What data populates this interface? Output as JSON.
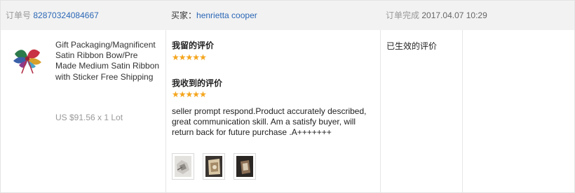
{
  "header": {
    "order_label": "订单号",
    "order_number": "82870324084667",
    "buyer_label": "买家：",
    "buyer_name": "henrietta cooper",
    "finish_label": "订单完成",
    "finish_time": "2017.04.07 10:29"
  },
  "product": {
    "title": "Gift Packaging/Magnificent Satin Ribbon Bow/Pre Made Medium Satin Ribbon with Sticker Free Shipping",
    "price": "US $91.56 x 1 Lot",
    "image_icon": "ribbon-bow-icon"
  },
  "feedback": {
    "my_rating_heading": "我留的评价",
    "my_rating_stars": 5,
    "received_heading": "我收到的评价",
    "received_stars": 5,
    "review_text": "seller prompt respond.Product accurately described, great communication skill. Am a satisfy buyer, will return back for future purchase .A+++++++",
    "photo_count": 3
  },
  "status": {
    "label": "已生效的评价"
  },
  "colors": {
    "header_bg": "#f2f2f2",
    "link": "#2b67b6",
    "star": "#f4a51c",
    "muted": "#999999"
  }
}
